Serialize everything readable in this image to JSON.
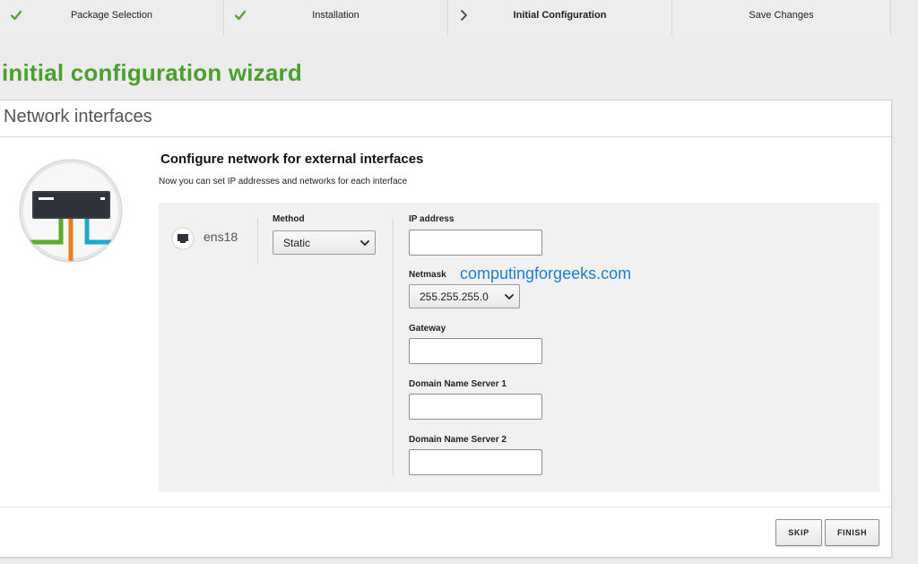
{
  "steps": [
    {
      "label": "Package Selection",
      "status": "done",
      "icon": "check-icon"
    },
    {
      "label": "Installation",
      "status": "done",
      "icon": "check-icon"
    },
    {
      "label": "Initial Configuration",
      "status": "active",
      "icon": "chevron-right-icon"
    },
    {
      "label": "Save Changes",
      "status": "pending",
      "icon": ""
    }
  ],
  "wizard_title": "initial configuration wizard",
  "card": {
    "header": "Network interfaces",
    "section_title": "Configure network for external interfaces",
    "section_subtitle": "Now you can set IP addresses and networks for each interface"
  },
  "interface": {
    "name": "ens18",
    "method_label": "Method",
    "method_value": "Static",
    "ip_label": "IP address",
    "ip_value": "",
    "netmask_label": "Netmask",
    "netmask_value": "255.255.255.0",
    "gateway_label": "Gateway",
    "gateway_value": "",
    "dns1_label": "Domain Name Server 1",
    "dns1_value": "",
    "dns2_label": "Domain Name Server 2",
    "dns2_value": ""
  },
  "watermark": "computingforgeeks.com",
  "buttons": {
    "skip": "SKIP",
    "finish": "FINISH"
  },
  "colors": {
    "accent_green": "#4aa02c",
    "check_green": "#5aa02c",
    "watermark_blue": "#1a7fd4"
  }
}
